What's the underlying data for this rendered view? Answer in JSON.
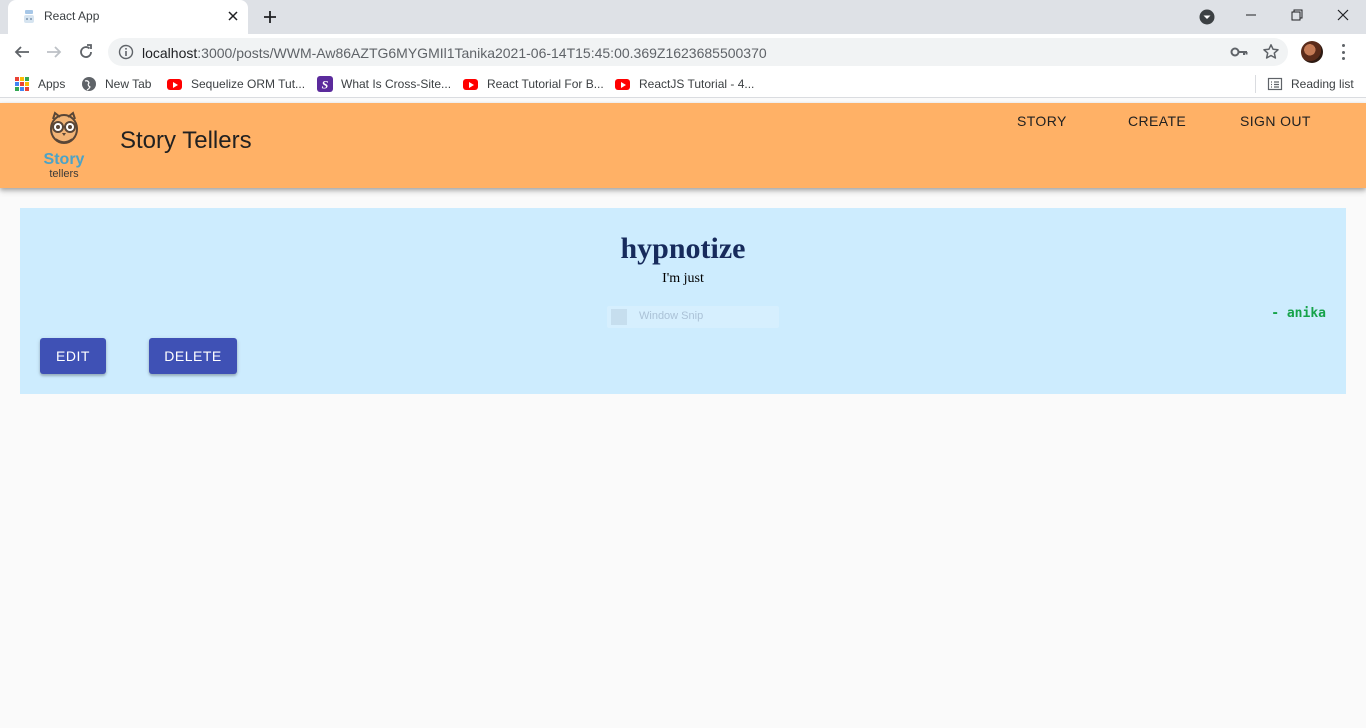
{
  "browser": {
    "tab_title": "React App",
    "url_host": "localhost",
    "url_rest": ":3000/posts/WWM-Aw86AZTG6MYGMIl1Tanika2021-06-14T15:45:00.369Z1623685500370",
    "bookmarks": [
      {
        "label": "Apps",
        "icon": "apps-grid-icon"
      },
      {
        "label": "New Tab",
        "icon": "globe-icon"
      },
      {
        "label": "Sequelize ORM Tut...",
        "icon": "youtube-icon"
      },
      {
        "label": "What Is Cross-Site...",
        "icon": "site-s-icon"
      },
      {
        "label": "React Tutorial For B...",
        "icon": "youtube-icon"
      },
      {
        "label": "ReactJS Tutorial - 4...",
        "icon": "youtube-icon"
      }
    ],
    "reading_list": "Reading list"
  },
  "app": {
    "logo_text_top": "Story",
    "logo_text_bottom": "tellers",
    "title": "Story Tellers",
    "nav": {
      "story": "STORY",
      "create": "CREATE",
      "sign_out": "SIGN OUT"
    },
    "header_color": "#ffb166"
  },
  "story": {
    "title": "hypnotize",
    "body": "I'm just",
    "author": "- anika",
    "overlay_text": "Window Snip",
    "edit_label": "EDIT",
    "delete_label": "DELETE",
    "button_color": "#3f51b5",
    "card_color": "#cdecfe"
  }
}
